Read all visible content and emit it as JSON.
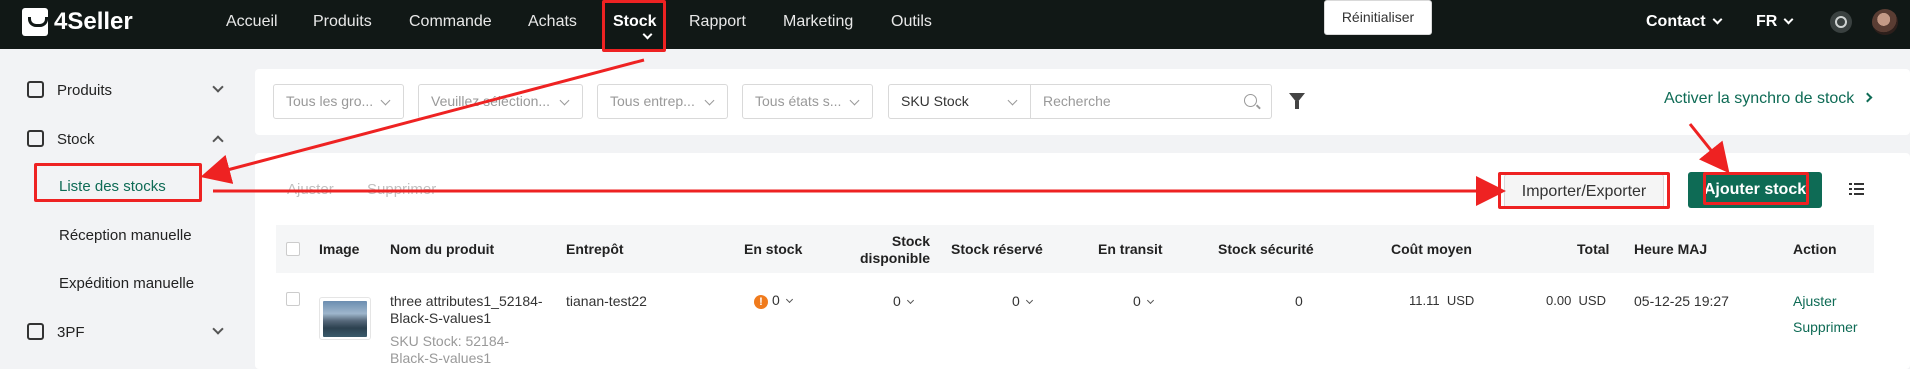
{
  "brand": {
    "name": "4Seller"
  },
  "nav": {
    "items": [
      "Accueil",
      "Produits",
      "Commande",
      "Achats",
      "Stock",
      "Rapport",
      "Marketing",
      "Outils"
    ],
    "active": "Stock"
  },
  "topright": {
    "contact": "Contact",
    "lang": "FR"
  },
  "sidebar": {
    "produits": "Produits",
    "stock": "Stock",
    "sub": [
      "Liste des stocks",
      "Réception manuelle",
      "Expédition manuelle"
    ],
    "pf": "3PF"
  },
  "filters": {
    "group": "Tous les gro...",
    "select": "Veuillez sélection...",
    "warehouse": "Tous entrep...",
    "states": "Tous états s...",
    "sku_type": "SKU Stock",
    "search_placeholder": "Recherche",
    "reset": "Réinitialiser"
  },
  "sync_link": "Activer la synchro de stock",
  "actions": {
    "adjust": "Ajuster",
    "delete": "Supprimer",
    "import_export": "Importer/Exporter",
    "add_stock": "Ajouter stock"
  },
  "table": {
    "headers": {
      "image": "Image",
      "name": "Nom du produit",
      "warehouse": "Entrepôt",
      "in_stock": "En stock",
      "available_1": "Stock",
      "available_2": "disponible",
      "reserved": "Stock réservé",
      "transit": "En transit",
      "safety": "Stock sécurité",
      "avg_cost": "Coût moyen",
      "total": "Total",
      "updated": "Heure MAJ",
      "action": "Action"
    },
    "row": {
      "name_1": "three attributes1_52184-",
      "name_2": "Black-S-values1",
      "sku_1": "SKU Stock: 52184-",
      "sku_2": "Black-S-values1",
      "warehouse": "tianan-test22",
      "in_stock": "0",
      "available": "0",
      "reserved": "0",
      "transit": "0",
      "safety": "0",
      "avg_cost": "11.11",
      "avg_cost_cur": "USD",
      "total": "0.00",
      "total_cur": "USD",
      "updated": "05-12-25 19:27",
      "act_adjust": "Ajuster",
      "act_delete": "Supprimer"
    }
  },
  "colors": {
    "accent": "#0e6b55",
    "topbar": "#111816",
    "highlight": "#ee2222",
    "warning": "#f07b1d"
  }
}
